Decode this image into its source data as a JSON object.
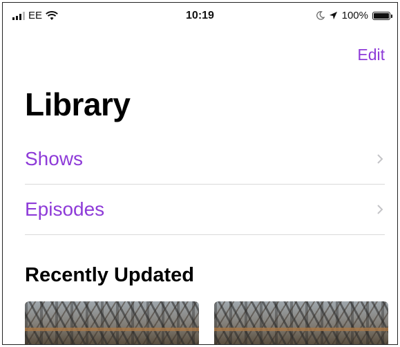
{
  "status_bar": {
    "carrier": "EE",
    "time": "10:19",
    "battery": "100%"
  },
  "nav": {
    "edit_label": "Edit"
  },
  "page": {
    "title": "Library"
  },
  "list": {
    "items": [
      {
        "label": "Shows"
      },
      {
        "label": "Episodes"
      }
    ]
  },
  "recent": {
    "title": "Recently Updated"
  },
  "colors": {
    "accent": "#8e3bd8"
  }
}
